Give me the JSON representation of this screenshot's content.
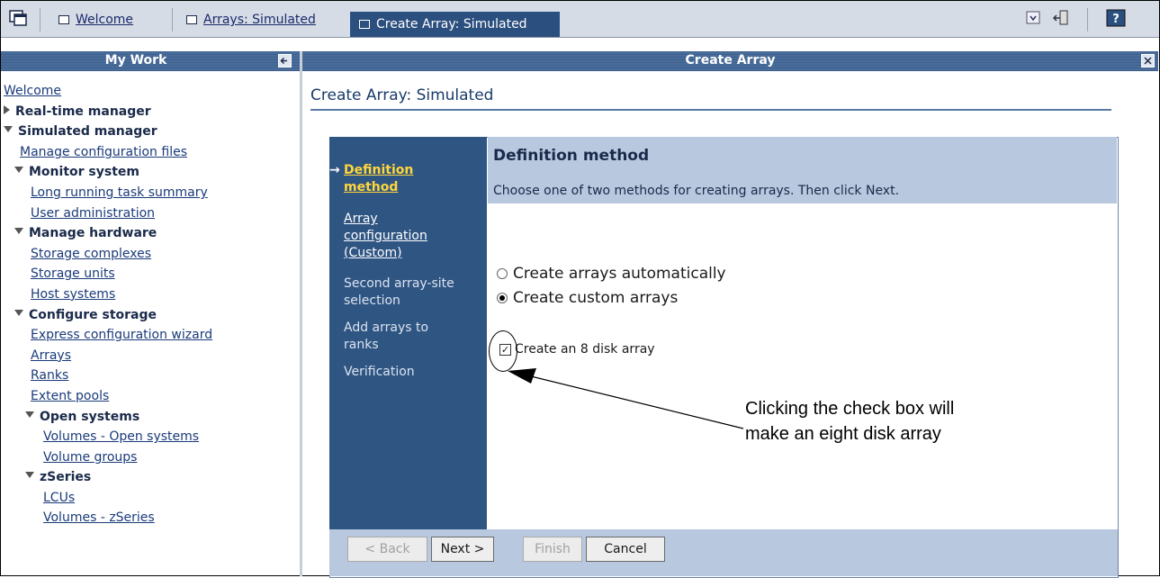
{
  "tabs": [
    {
      "label": "Welcome"
    },
    {
      "label": "Arrays: Simulated"
    },
    {
      "label": "Create Array: Simulated"
    }
  ],
  "left_panel": {
    "title": "My Work"
  },
  "right_panel": {
    "title": "Create Array"
  },
  "nav": {
    "welcome": "Welcome",
    "realtime": "Real-time manager",
    "simulated": "Simulated manager",
    "manage_config": "Manage configuration files",
    "monitor": "Monitor system",
    "long_running": "Long running task summary",
    "user_admin": "User administration",
    "manage_hw": "Manage hardware",
    "storage_complexes": "Storage complexes",
    "storage_units": "Storage units",
    "host_systems": "Host systems",
    "configure_storage": "Configure storage",
    "express_wizard": "Express configuration wizard",
    "arrays": "Arrays",
    "ranks": "Ranks",
    "extent_pools": "Extent pools",
    "open_systems": "Open systems",
    "volumes_open": "Volumes - Open systems",
    "volume_groups": "Volume groups",
    "zseries": "zSeries",
    "lcus": "LCUs",
    "volumes_zseries": "Volumes - zSeries"
  },
  "main": {
    "page_title": "Create Array: Simulated",
    "steps": {
      "s1": "Definition method",
      "s2": "Array configuration (Custom)",
      "s3": "Second array-site selection",
      "s4": "Add arrays to ranks",
      "s5": "Verification"
    },
    "section_title": "Definition method",
    "section_desc": "Choose one of two methods for creating arrays. Then click Next.",
    "radio_auto": "Create arrays automatically",
    "radio_custom": "Create custom arrays",
    "checkbox_label": "Create an 8 disk array",
    "buttons": {
      "back": "< Back",
      "next": "Next >",
      "finish": "Finish",
      "cancel": "Cancel"
    }
  },
  "annotation": {
    "line1": "Clicking the check box will",
    "line2": "make an eight disk array"
  },
  "icons": [
    "window-icon",
    "portlet-icon",
    "logout-icon",
    "help-icon",
    "collapse-icon",
    "close-icon"
  ]
}
